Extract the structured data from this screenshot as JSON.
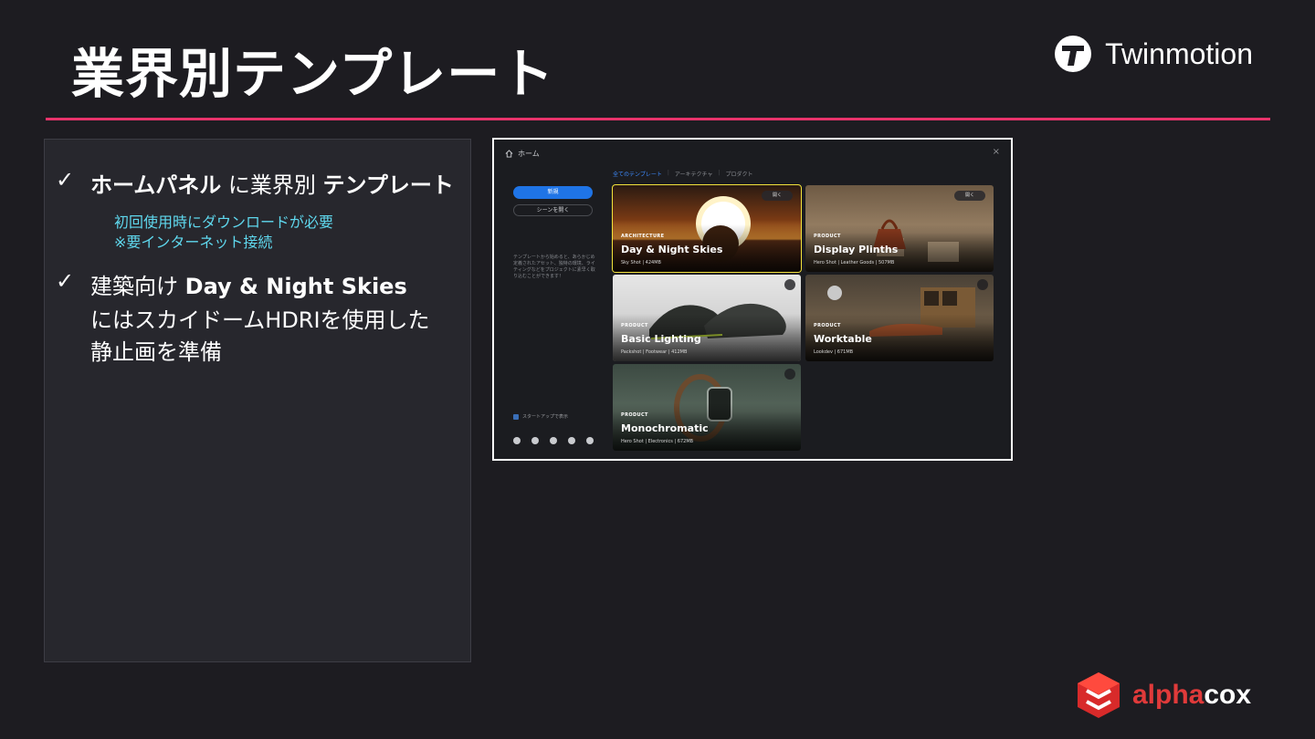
{
  "slide": {
    "title": "業界別テンプレート"
  },
  "brand": {
    "name": "Twinmotion"
  },
  "bullets": [
    {
      "check": "✓",
      "bold1": "ホームパネル",
      "text1": " に業界別 ",
      "bold2": "テンプレート",
      "sub1": "初回使用時にダウンロードが必要",
      "sub2": "※要インターネット接続"
    },
    {
      "check": "✓",
      "text1": "建築向け ",
      "bold1": "Day & Night Skies",
      "line2": "にはスカイドームHDRIを使用した",
      "line3": "静止画を準備"
    }
  ],
  "app": {
    "home_label": "ホーム",
    "close_glyph": "×",
    "new_button": "新規",
    "open_scene_button": "シーンを開く",
    "sidebar_text": "テンプレートから始めると、あらかじめ定義されたアセット、独特の環境、ライティングなどをプロジェクトに素早く取り込むことができます！",
    "startup_label": "スタートアップで表示",
    "tabs": [
      "全てのテンプレート",
      "アーキテクチャ",
      "プロダクト"
    ],
    "cards": [
      {
        "category": "ARCHITECTURE",
        "name": "Day & Night Skies",
        "meta": "Sky Shot  |  424MB",
        "action": "開く"
      },
      {
        "category": "PRODUCT",
        "name": "Display Plinths",
        "meta": "Hero Shot  |  Leather Goods  |  507MB",
        "action": "開く"
      },
      {
        "category": "PRODUCT",
        "name": "Basic Lighting",
        "meta": "Packshot  |  Footwear  |  412MB"
      },
      {
        "category": "PRODUCT",
        "name": "Worktable",
        "meta": "Lookdev  |  671MB"
      },
      {
        "category": "PRODUCT",
        "name": "Monochromatic",
        "meta": "Hero Shot  |  Electronics  |  672MB"
      }
    ]
  },
  "footer": {
    "logo_part1": "alpha",
    "logo_part2": "cox"
  },
  "colors": {
    "accent_line": "#e8336b",
    "highlight": "#f2e23b",
    "sub_text": "#5fd8ee",
    "app_primary": "#1f74e6"
  }
}
